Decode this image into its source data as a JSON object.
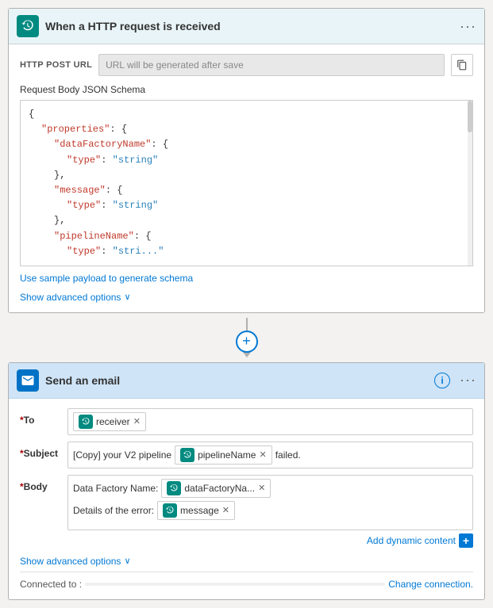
{
  "http_card": {
    "title": "When a HTTP request is received",
    "header_label": "HTTP POST URL",
    "url_placeholder": "URL will be generated after save",
    "schema_label": "Request Body JSON Schema",
    "json_lines": [
      {
        "indent": 0,
        "content": "{"
      },
      {
        "indent": 1,
        "key": "\"properties\"",
        "colon": ": {"
      },
      {
        "indent": 2,
        "key": "\"dataFactoryName\"",
        "colon": ": {"
      },
      {
        "indent": 3,
        "key": "\"type\"",
        "colon": ": ",
        "val": "\"string\""
      },
      {
        "indent": 2,
        "content": "},"
      },
      {
        "indent": 2,
        "key": "\"message\"",
        "colon": ": {"
      },
      {
        "indent": 3,
        "key": "\"type\"",
        "colon": ": ",
        "val": "\"string\""
      },
      {
        "indent": 2,
        "content": "},"
      },
      {
        "indent": 2,
        "key": "\"pipelineName\"",
        "colon": ": {"
      },
      {
        "indent": 3,
        "key": "\"type\"",
        "colon": ": ",
        "val": "\"stri...\""
      }
    ],
    "schema_link": "Use sample payload to generate schema",
    "show_advanced": "Show advanced options"
  },
  "connector": {
    "plus_symbol": "+"
  },
  "email_card": {
    "title": "Send an email",
    "to_label": "*To",
    "to_tag": "receiver",
    "subject_label": "*Subject",
    "subject_prefix": "[Copy] your V2 pipeline",
    "subject_tag": "pipelineName",
    "subject_suffix": "failed.",
    "body_label": "*Body",
    "body_line1_text": "Data Factory Name:",
    "body_line1_tag": "dataFactoryNa...",
    "body_line2_text": "Details of the error:",
    "body_line2_tag": "message",
    "add_dynamic_label": "Add dynamic content",
    "show_advanced": "Show advanced options",
    "connected_label": "Connected to :",
    "connected_value": "",
    "change_connection": "Change connection."
  }
}
